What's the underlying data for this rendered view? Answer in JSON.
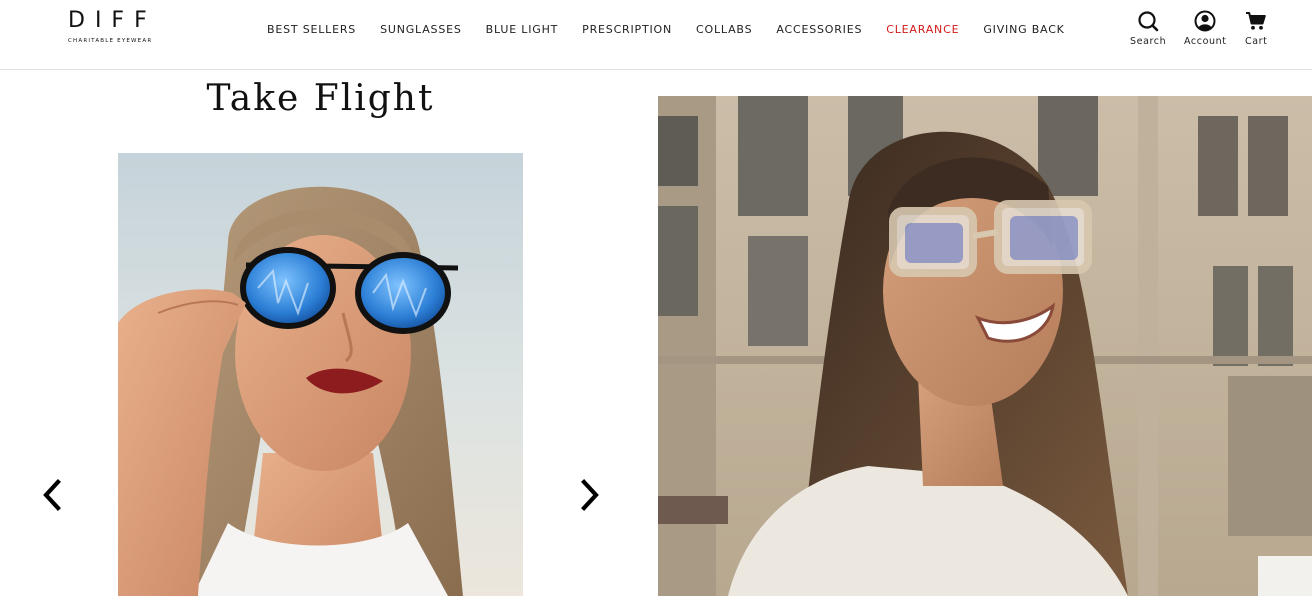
{
  "brand": {
    "name": "DIFF",
    "tagline": "CHARITABLE EYEWEAR"
  },
  "nav": {
    "items": [
      {
        "label": "BEST SELLERS"
      },
      {
        "label": "SUNGLASSES"
      },
      {
        "label": "BLUE LIGHT"
      },
      {
        "label": "PRESCRIPTION"
      },
      {
        "label": "COLLABS"
      },
      {
        "label": "ACCESSORIES"
      },
      {
        "label": "CLEARANCE"
      },
      {
        "label": "GIVING BACK"
      }
    ],
    "highlight_color": "#d21a1a"
  },
  "utility": {
    "search_label": "Search",
    "account_label": "Account",
    "cart_label": "Cart"
  },
  "promo": {
    "title": "Take Flight"
  },
  "icons": {
    "search": "search-icon",
    "account": "account-icon",
    "cart": "cart-icon",
    "prev": "chevron-left-icon",
    "next": "chevron-right-icon"
  }
}
